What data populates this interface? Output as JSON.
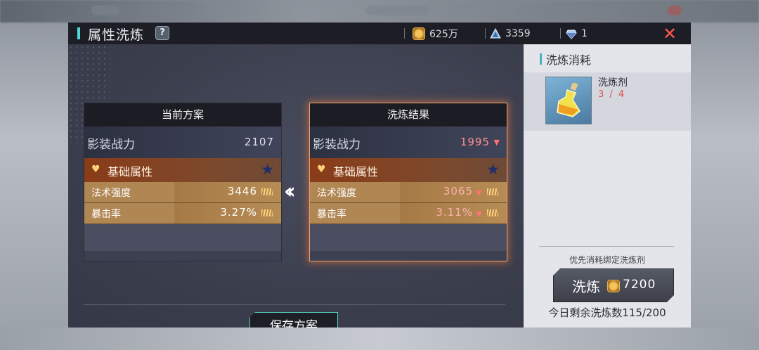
{
  "header": {
    "title": "属性洗炼",
    "currencies": [
      {
        "icon": "coin-icon",
        "value": "625万"
      },
      {
        "icon": "crystal-icon",
        "value": "3359"
      },
      {
        "icon": "diamond-icon",
        "value": "1"
      }
    ]
  },
  "current_card": {
    "title": "当前方案",
    "power_label": "影装战力",
    "power_value": "2107",
    "section_label": "基础属性",
    "attrs": [
      {
        "label": "法术强度",
        "value": "3446"
      },
      {
        "label": "暴击率",
        "value": "3.27%"
      }
    ]
  },
  "result_card": {
    "title": "洗炼结果",
    "power_label": "影装战力",
    "power_value": "1995",
    "section_label": "基础属性",
    "attrs": [
      {
        "label": "法术强度",
        "value": "3065"
      },
      {
        "label": "暴击率",
        "value": "3.11%"
      }
    ]
  },
  "save_button": "保存方案",
  "cost_panel": {
    "title": "洗炼消耗",
    "item_name": "洗炼剂",
    "item_count": "3 / 4",
    "prefer_text": "优先消耗绑定洗炼剂",
    "wash_label": "洗炼",
    "wash_cost": "7200",
    "remain_text": "今日剩余洗炼数115/200"
  },
  "colors": {
    "accent": "#4fd6d8",
    "decrease": "#ff7070",
    "close": "#ff5a4a"
  }
}
